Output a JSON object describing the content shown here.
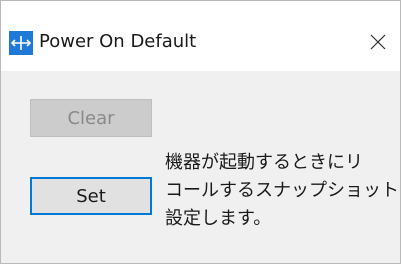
{
  "window": {
    "title": "Power On Default",
    "icon": "app-arrows-icon",
    "close_icon": "close-icon"
  },
  "buttons": {
    "clear_label": "Clear",
    "clear_enabled": false,
    "set_label": "Set",
    "set_focused": true
  },
  "description": {
    "line1": "機器が起動するときにリ",
    "line2": "コールするスナップショットを",
    "line3": "設定します。"
  },
  "colors": {
    "accent": "#0078d7",
    "icon_bg": "#1e7ad6"
  }
}
